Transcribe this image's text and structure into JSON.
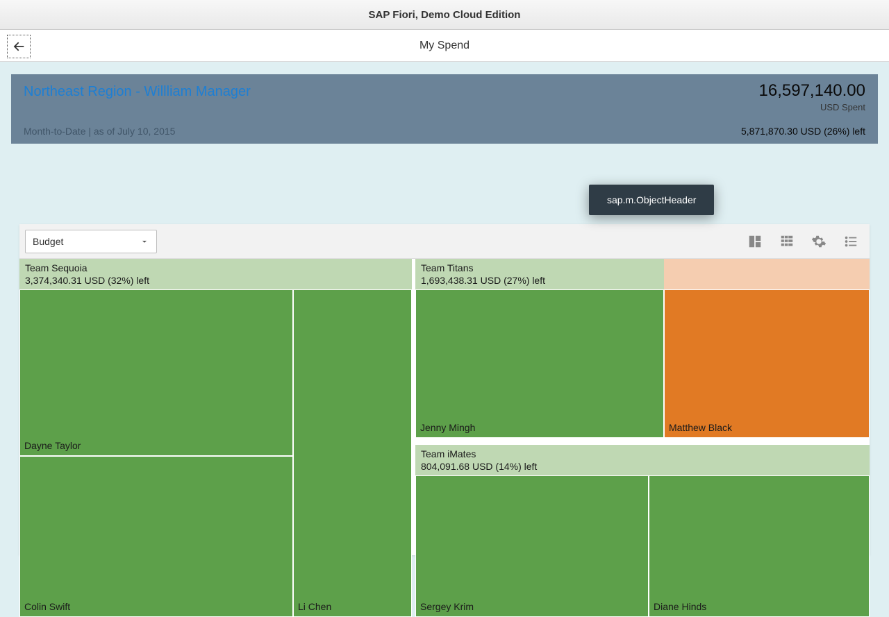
{
  "shell": {
    "title": "SAP Fiori, Demo Cloud Edition"
  },
  "page": {
    "title": "My Spend"
  },
  "header": {
    "title": "Northeast Region - Willliam Manager",
    "subtitle": "Month-to-Date | as of July 10, 2015",
    "amount": "16,597,140.00",
    "amount_unit": "USD Spent",
    "remaining": "5,871,870.30 USD (26%) left"
  },
  "tooltip": {
    "text": "sap.m.ObjectHeader"
  },
  "toolbar": {
    "select_label": "Budget",
    "icon_treemap": "treemap-icon",
    "icon_table": "table-icon",
    "icon_settings": "gear-icon",
    "icon_list": "list-icon"
  },
  "treemap": {
    "teams": [
      {
        "id": "sequoia",
        "name": "Team Sequoia",
        "summary": "3,374,340.31 USD (32%) left",
        "members": [
          {
            "name": "Dayne Taylor"
          },
          {
            "name": "Colin Swift"
          },
          {
            "name": "Li Chen"
          }
        ]
      },
      {
        "id": "titans",
        "name": "Team Titans",
        "summary": "1,693,438.31 USD (27%) left",
        "members": [
          {
            "name": "Jenny Mingh"
          },
          {
            "name": "Matthew Black"
          }
        ]
      },
      {
        "id": "imates",
        "name": "Team iMates",
        "summary": "804,091.68 USD (14%) left",
        "members": [
          {
            "name": "Sergey Krim"
          },
          {
            "name": "Diane Hinds"
          }
        ]
      }
    ]
  },
  "chart_data": {
    "type": "treemap",
    "title": "My Spend — Budget view",
    "unit": "USD",
    "total_spent": 16597140.0,
    "remaining_usd": 5871870.3,
    "remaining_pct": 26,
    "groups": [
      {
        "name": "Team Sequoia",
        "remaining_usd": 3374340.31,
        "remaining_pct": 32,
        "members": [
          "Dayne Taylor",
          "Colin Swift",
          "Li Chen"
        ]
      },
      {
        "name": "Team Titans",
        "remaining_usd": 1693438.31,
        "remaining_pct": 27,
        "members": [
          "Jenny Mingh",
          "Matthew Black"
        ]
      },
      {
        "name": "Team iMates",
        "remaining_usd": 804091.68,
        "remaining_pct": 14,
        "members": [
          "Sergey Krim",
          "Diane Hinds"
        ]
      }
    ]
  }
}
